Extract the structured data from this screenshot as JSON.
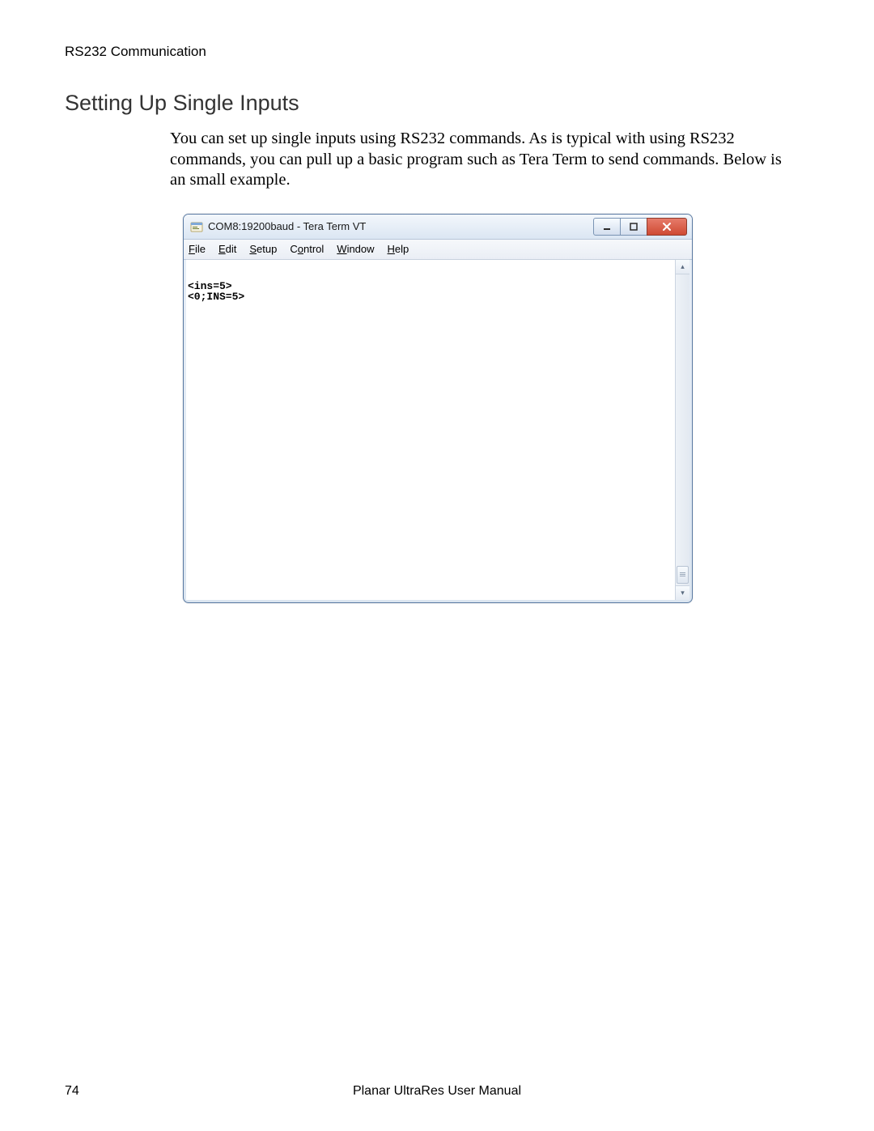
{
  "header": {
    "running": "RS232 Communication"
  },
  "section": {
    "heading": "Setting Up Single Inputs"
  },
  "body": {
    "paragraph": "You can set up single inputs using RS232 commands. As is typical with using RS232 commands, you can pull up a basic program such as Tera Term to send commands. Below is an small example."
  },
  "teraterm": {
    "title": "COM8:19200baud - Tera Term VT",
    "menu": {
      "file": {
        "label": "File",
        "hotkey_index": 0
      },
      "edit": {
        "label": "Edit",
        "hotkey_index": 0
      },
      "setup": {
        "label": "Setup",
        "hotkey_index": 0
      },
      "control": {
        "label": "Control",
        "hotkey_index": 1
      },
      "window": {
        "label": "Window",
        "hotkey_index": 0
      },
      "help": {
        "label": "Help",
        "hotkey_index": 0
      }
    },
    "terminal_lines": [
      "<ins=5>",
      "<0;INS=5>"
    ],
    "window_controls": {
      "minimize_tooltip": "Minimize",
      "maximize_tooltip": "Maximize",
      "close_tooltip": "Close"
    }
  },
  "footer": {
    "page_number": "74",
    "center": "Planar UltraRes User Manual"
  }
}
